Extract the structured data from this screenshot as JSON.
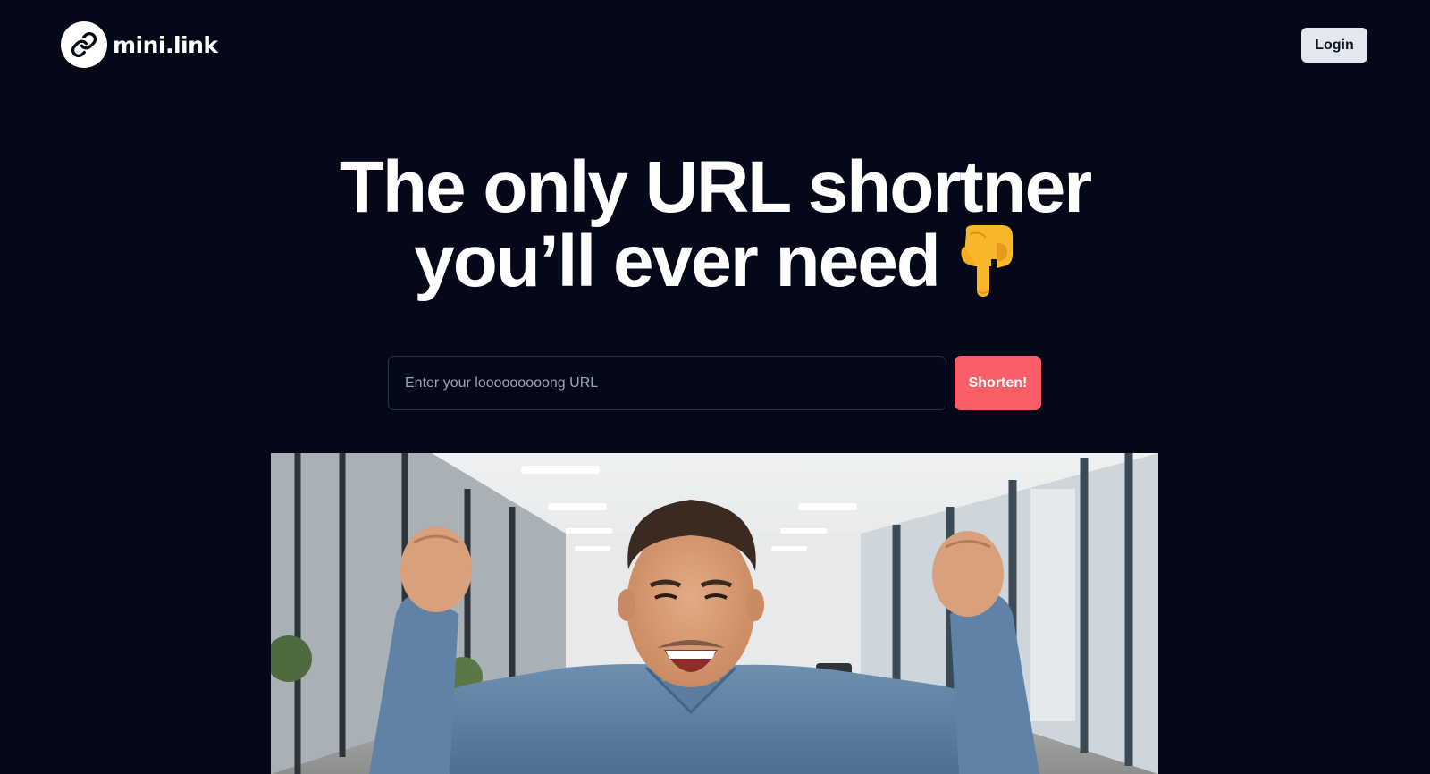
{
  "header": {
    "logo_text": "mini.link",
    "login_label": "Login"
  },
  "hero": {
    "headline_line1": "The only URL shortner",
    "headline_line2": "you’ll ever need",
    "headline_emoji_icon": "pointing-down-hand-icon"
  },
  "form": {
    "url_placeholder": "Enter your looooooooong URL",
    "url_value": "",
    "shorten_label": "Shorten!"
  },
  "image": {
    "subject": "celebrating-man-in-office-photo"
  },
  "colors": {
    "background": "#040818",
    "accent_button": "#fa5f67",
    "login_button_bg": "#e3e8f0"
  }
}
